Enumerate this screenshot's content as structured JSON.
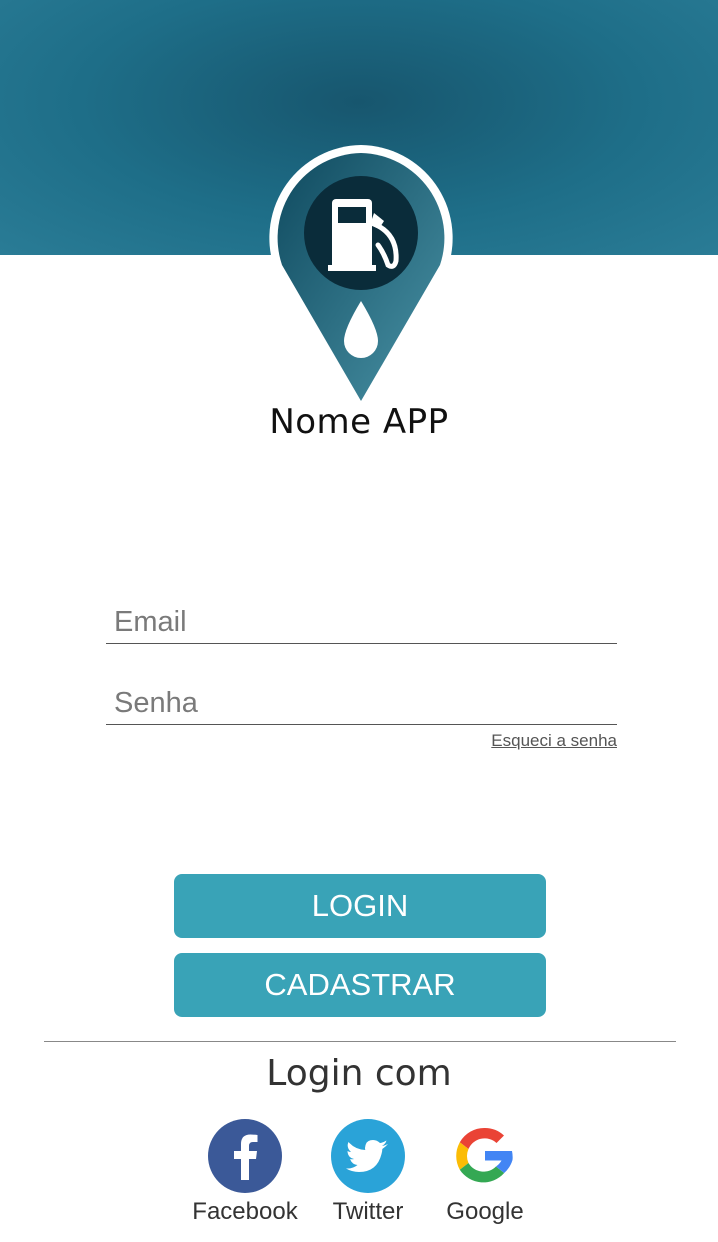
{
  "header": {
    "logo_icon": "fuel-pump-pin-icon",
    "app_name": "Nome APP",
    "colors": {
      "band": "#1e6e88",
      "pin_dark": "#0e3f52",
      "pin_light": "#3d8ea3"
    }
  },
  "form": {
    "email_placeholder": "Email",
    "password_placeholder": "Senha",
    "forgot_password": "Esqueci a senha"
  },
  "buttons": {
    "login": "LOGIN",
    "signup": "CADASTRAR",
    "color": "#39a3b7"
  },
  "social": {
    "title": "Login com",
    "providers": [
      {
        "label": "Facebook",
        "icon": "facebook-icon",
        "color": "#3b5998"
      },
      {
        "label": "Twitter",
        "icon": "twitter-icon",
        "color": "#2aa3d8"
      },
      {
        "label": "Google",
        "icon": "google-icon",
        "color": "#4285f4"
      }
    ]
  }
}
